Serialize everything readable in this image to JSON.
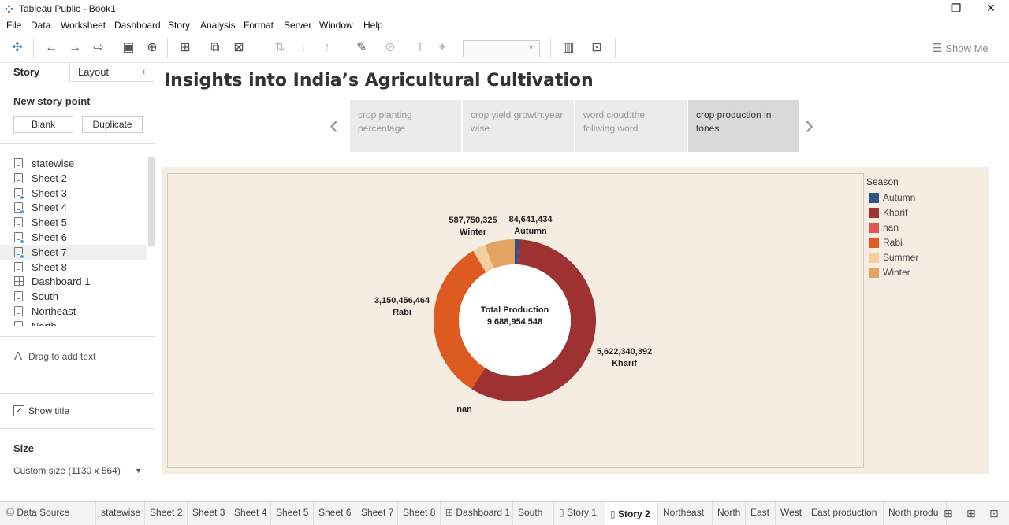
{
  "window": {
    "title": "Tableau Public - Book1",
    "controls": [
      "—",
      "❐",
      "✕"
    ]
  },
  "menu": [
    "File",
    "Data",
    "Worksheet",
    "Dashboard",
    "Story",
    "Analysis",
    "Format",
    "Server",
    "Window",
    "Help"
  ],
  "toolbar": {
    "show_me": "Show Me"
  },
  "sidebar": {
    "tabs": [
      "Story",
      "Layout"
    ],
    "new_story_point": "New story point",
    "blank_button": "Blank",
    "duplicate_button": "Duplicate",
    "sheets": [
      {
        "label": "statewise",
        "type": "sheet",
        "badge": false
      },
      {
        "label": "Sheet 2",
        "type": "sheet",
        "badge": false
      },
      {
        "label": "Sheet 3",
        "type": "sheet",
        "badge": true
      },
      {
        "label": "Sheet 4",
        "type": "sheet",
        "badge": true
      },
      {
        "label": "Sheet 5",
        "type": "sheet",
        "badge": false
      },
      {
        "label": "Sheet 6",
        "type": "sheet",
        "badge": true
      },
      {
        "label": "Sheet 7",
        "type": "sheet",
        "badge": true
      },
      {
        "label": "Sheet 8",
        "type": "sheet",
        "badge": false
      },
      {
        "label": "Dashboard 1",
        "type": "dashboard",
        "badge": false
      },
      {
        "label": "South",
        "type": "sheet",
        "badge": false
      },
      {
        "label": "Northeast",
        "type": "sheet",
        "badge": false
      },
      {
        "label": "North",
        "type": "sheet",
        "badge": false
      }
    ],
    "drag_text": "Drag to add text",
    "show_title": "Show title",
    "size_label": "Size",
    "size_value": "Custom size (1130 x 564)"
  },
  "story": {
    "title": "Insights into India’s Agricultural Cultivation",
    "points": [
      {
        "text": "crop planting percentage",
        "active": false
      },
      {
        "text": "crop yield growth:year wise",
        "active": false
      },
      {
        "text": "word cloud:the follwing word",
        "active": false
      },
      {
        "text": "crop production in tones",
        "active": true
      }
    ]
  },
  "chart_data": {
    "type": "pie",
    "variant": "donut",
    "center_label": "Total Production",
    "center_value": "9,688,954,548",
    "legend_title": "Season",
    "slices": [
      {
        "name": "Autumn",
        "value": 84641434,
        "label": "84,641,434",
        "color": "#2d5487"
      },
      {
        "name": "Kharif",
        "value": 5622340392,
        "label": "5,622,340,392",
        "color": "#9e3232"
      },
      {
        "name": "nan",
        "value": 0,
        "label": "",
        "color": "#e05555"
      },
      {
        "name": "Rabi",
        "value": 3150456464,
        "label": "3,150,456,464",
        "color": "#dd5b20"
      },
      {
        "name": "Summer",
        "value": 243760000,
        "label": "",
        "color": "#f1cf9f"
      },
      {
        "name": "Winter",
        "value": 587750325,
        "label": "587,750,325",
        "color": "#e3a463"
      }
    ]
  },
  "bottom_tabs": [
    {
      "label": "Data Source",
      "icon": "db"
    },
    {
      "label": "statewise"
    },
    {
      "label": "Sheet 2"
    },
    {
      "label": "Sheet 3"
    },
    {
      "label": "Sheet 4"
    },
    {
      "label": "Sheet 5"
    },
    {
      "label": "Sheet 6"
    },
    {
      "label": "Sheet 7"
    },
    {
      "label": "Sheet 8"
    },
    {
      "label": "Dashboard 1",
      "icon": "dash"
    },
    {
      "label": "South"
    },
    {
      "label": "Story 1",
      "icon": "story"
    },
    {
      "label": "Story 2",
      "icon": "story",
      "active": true
    },
    {
      "label": "Northeast"
    },
    {
      "label": "North"
    },
    {
      "label": "East"
    },
    {
      "label": "West"
    },
    {
      "label": "East production"
    },
    {
      "label": "North produ"
    }
  ]
}
